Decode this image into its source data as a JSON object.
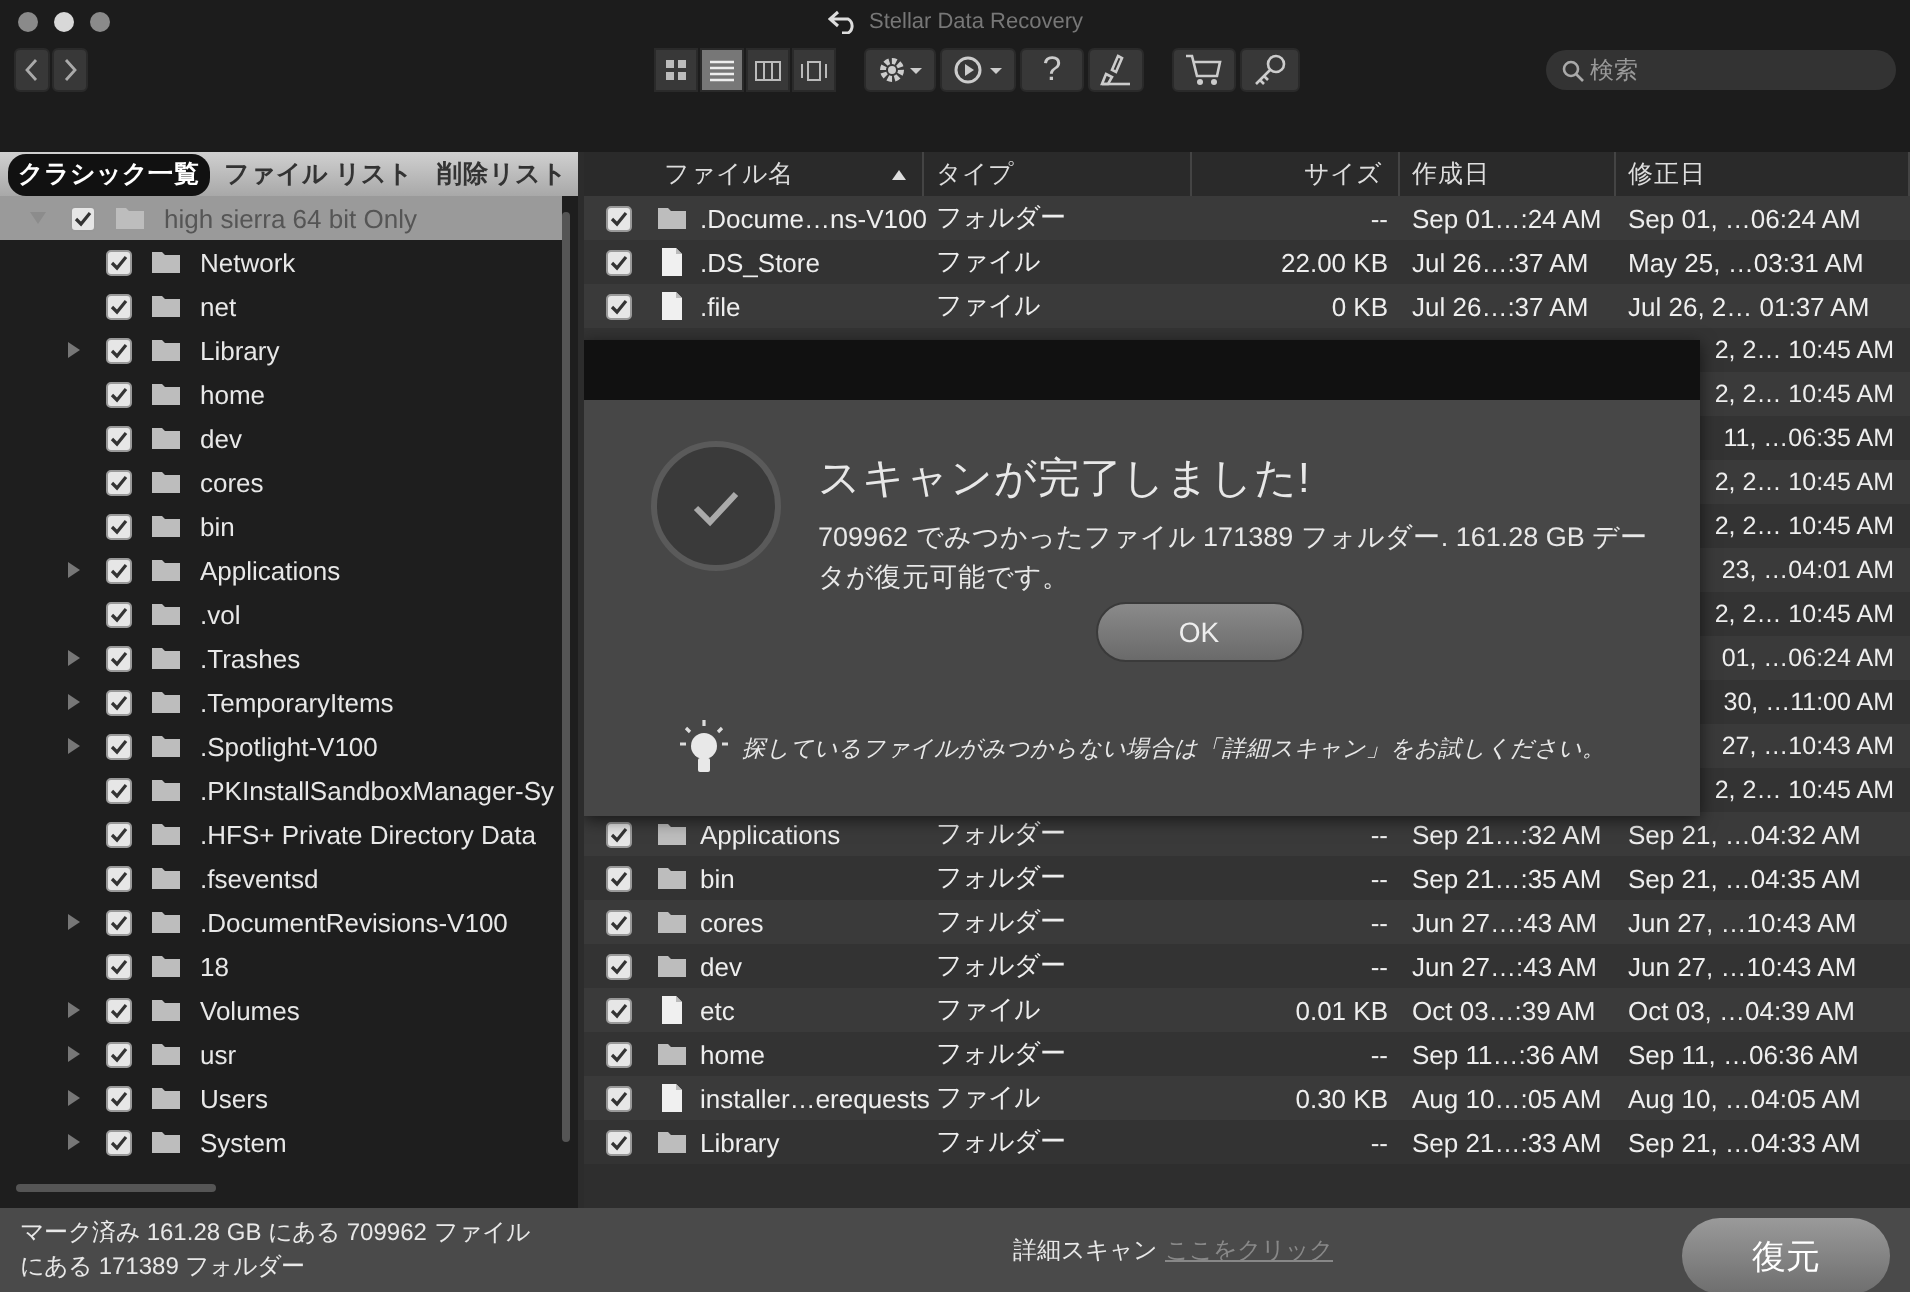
{
  "window": {
    "title": "Stellar Data Recovery"
  },
  "toolbar": {
    "view_modes": [
      {
        "kind": "grid",
        "selected": false
      },
      {
        "kind": "list",
        "selected": true
      },
      {
        "kind": "columns",
        "selected": false
      },
      {
        "kind": "coverflow",
        "selected": false
      }
    ],
    "help": "?",
    "search": {
      "placeholder": "検索"
    }
  },
  "sidebar": {
    "tabs": [
      {
        "label": "クラシック一覧",
        "selected": true
      },
      {
        "label": "ファイル リスト",
        "selected": false
      },
      {
        "label": "削除リスト",
        "selected": false
      }
    ],
    "tree": [
      {
        "name": "high sierra 64 bit Only",
        "checked": true,
        "selected": true,
        "kind": "branch",
        "expanded": true,
        "children": [
          {
            "name": "Network",
            "checked": true,
            "selected": false,
            "kind": "leaf"
          },
          {
            "name": "net",
            "checked": true,
            "selected": false,
            "kind": "leaf"
          },
          {
            "name": "Library",
            "checked": true,
            "selected": false,
            "kind": "branch"
          },
          {
            "name": "home",
            "checked": true,
            "selected": false,
            "kind": "leaf"
          },
          {
            "name": "dev",
            "checked": true,
            "selected": false,
            "kind": "leaf"
          },
          {
            "name": "cores",
            "checked": true,
            "selected": false,
            "kind": "leaf"
          },
          {
            "name": "bin",
            "checked": true,
            "selected": false,
            "kind": "leaf"
          },
          {
            "name": "Applications",
            "checked": true,
            "selected": false,
            "kind": "branch"
          },
          {
            "name": ".vol",
            "checked": true,
            "selected": false,
            "kind": "leaf"
          },
          {
            "name": ".Trashes",
            "checked": true,
            "selected": false,
            "kind": "branch"
          },
          {
            "name": ".TemporaryItems",
            "checked": true,
            "selected": false,
            "kind": "branch"
          },
          {
            "name": ".Spotlight-V100",
            "checked": true,
            "selected": false,
            "kind": "branch"
          },
          {
            "name": ".PKInstallSandboxManager-Sy",
            "checked": true,
            "selected": false,
            "kind": "leaf"
          },
          {
            "name": ".HFS+ Private Directory Data",
            "checked": true,
            "selected": false,
            "kind": "leaf"
          },
          {
            "name": ".fseventsd",
            "checked": true,
            "selected": false,
            "kind": "leaf"
          },
          {
            "name": ".DocumentRevisions-V100",
            "checked": true,
            "selected": false,
            "kind": "branch"
          },
          {
            "name": "18",
            "checked": true,
            "selected": false,
            "kind": "leaf"
          },
          {
            "name": "Volumes",
            "checked": true,
            "selected": false,
            "kind": "branch"
          },
          {
            "name": "usr",
            "checked": true,
            "selected": false,
            "kind": "branch"
          },
          {
            "name": "Users",
            "checked": true,
            "selected": false,
            "kind": "branch"
          },
          {
            "name": "System",
            "checked": true,
            "selected": false,
            "kind": "branch"
          }
        ]
      }
    ]
  },
  "table": {
    "columns": [
      {
        "label": "ファイル名",
        "sorted": true
      },
      {
        "label": "タイプ",
        "sorted": false
      },
      {
        "label": "サイズ",
        "sorted": false
      },
      {
        "label": "作成日",
        "sorted": false
      },
      {
        "label": "修正日",
        "sorted": false
      }
    ],
    "rows": [
      {
        "kind": "folder",
        "checked": true,
        "name": ".Docume…ns-V100",
        "type": "フォルダー",
        "size": "--",
        "created": "Sep 01…:24 AM",
        "modified": "Sep 01, …06:24 AM"
      },
      {
        "kind": "file",
        "checked": true,
        "name": ".DS_Store",
        "type": "ファイル",
        "size": "22.00 KB",
        "created": "Jul 26…:37 AM",
        "modified": "May 25, …03:31 AM"
      },
      {
        "kind": "file",
        "checked": true,
        "name": ".file",
        "type": "ファイル",
        "size": "0  KB",
        "created": "Jul 26…:37 AM",
        "modified": "Jul 26, 2… 01:37 AM"
      },
      {
        "kind": "covered",
        "modified": "2, 2… 10:45 AM"
      },
      {
        "kind": "covered",
        "modified": "2, 2… 10:45 AM"
      },
      {
        "kind": "covered",
        "modified": "11, …06:35 AM"
      },
      {
        "kind": "covered",
        "modified": "2, 2… 10:45 AM"
      },
      {
        "kind": "covered",
        "modified": "2, 2… 10:45 AM"
      },
      {
        "kind": "covered",
        "modified": "23, …04:01 AM"
      },
      {
        "kind": "covered",
        "modified": "2, 2… 10:45 AM"
      },
      {
        "kind": "covered",
        "modified": "01, …06:24 AM"
      },
      {
        "kind": "covered",
        "modified": "30, …11:00 AM"
      },
      {
        "kind": "covered",
        "modified": "27, …10:43 AM"
      },
      {
        "kind": "covered",
        "modified": "2, 2… 10:45 AM"
      },
      {
        "kind": "folder",
        "checked": true,
        "name": "Applications",
        "type": "フォルダー",
        "size": "--",
        "created": "Sep 21…:32 AM",
        "modified": "Sep 21, …04:32 AM"
      },
      {
        "kind": "folder",
        "checked": true,
        "name": "bin",
        "type": "フォルダー",
        "size": "--",
        "created": "Sep 21…:35 AM",
        "modified": "Sep 21, …04:35 AM"
      },
      {
        "kind": "folder",
        "checked": true,
        "name": "cores",
        "type": "フォルダー",
        "size": "--",
        "created": "Jun 27…:43 AM",
        "modified": "Jun 27, …10:43 AM"
      },
      {
        "kind": "folder",
        "checked": true,
        "name": "dev",
        "type": "フォルダー",
        "size": "--",
        "created": "Jun 27…:43 AM",
        "modified": "Jun 27, …10:43 AM"
      },
      {
        "kind": "file",
        "checked": true,
        "name": "etc",
        "type": "ファイル",
        "size": "0.01 KB",
        "created": "Oct 03…:39 AM",
        "modified": "Oct 03, …04:39 AM"
      },
      {
        "kind": "folder",
        "checked": true,
        "name": "home",
        "type": "フォルダー",
        "size": "--",
        "created": "Sep 11…:36 AM",
        "modified": "Sep 11, …06:36 AM"
      },
      {
        "kind": "file",
        "checked": true,
        "name": "installer…erequests",
        "type": "ファイル",
        "size": "0.30 KB",
        "created": "Aug 10…:05 AM",
        "modified": "Aug 10, …04:05 AM"
      },
      {
        "kind": "folder",
        "checked": true,
        "name": "Library",
        "type": "フォルダー",
        "size": "--",
        "created": "Sep 21…:33 AM",
        "modified": "Sep 21, …04:33 AM"
      }
    ]
  },
  "dialog": {
    "title": "スキャンが完了しました!",
    "message": "709962 でみつかったファイル 171389 フォルダー. 161.28 GB データが復元可能です。",
    "ok": "OK",
    "tip": "探しているファイルがみつからない場合は「詳細スキャン」をお試しください。"
  },
  "status_bar": {
    "summary": "マーク済み 161.28 GB にある 709962 ファイルにある 171389 フォルダー",
    "deep_scan_label": "詳細スキャン",
    "deep_scan_link": "ここをクリック",
    "recover": "復元"
  }
}
